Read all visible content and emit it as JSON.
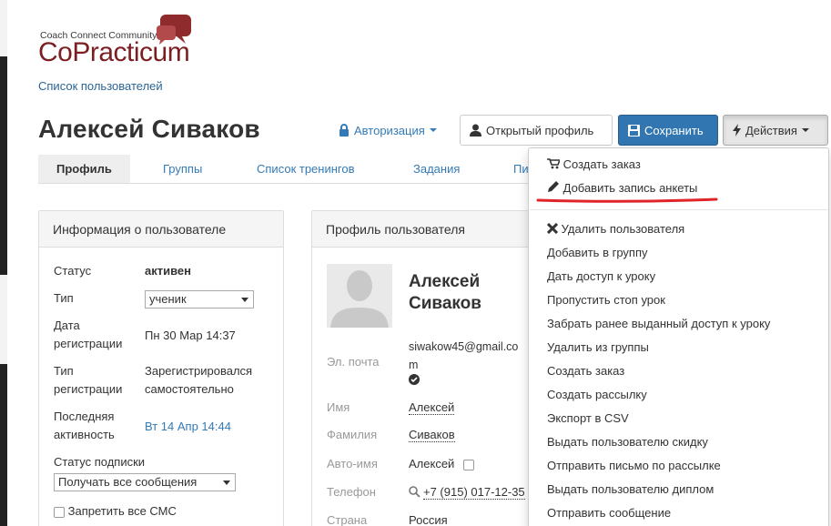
{
  "logo": {
    "tagline": "Coach Connect Community",
    "brand": "CoPracticum",
    "brand_color": "#7a1f22"
  },
  "breadcrumb": {
    "back_link": "Список пользователей"
  },
  "user": {
    "full_name": "Алексей Сиваков"
  },
  "toolbar": {
    "auth_label": "Авторизация",
    "auth_icon": "lock-icon",
    "open_profile_label": "Открытый профиль",
    "open_profile_icon": "user-icon",
    "save_label": "Сохранить",
    "save_icon": "floppy-icon",
    "actions_label": "Действия",
    "actions_icon": "bolt-icon",
    "save_color": "#3276b1"
  },
  "tabs": [
    {
      "label": "Профиль",
      "active": true
    },
    {
      "label": "Группы"
    },
    {
      "label": "Список тренингов"
    },
    {
      "label": "Задания"
    },
    {
      "label": "Пи"
    }
  ],
  "info_panel": {
    "title": "Информация о пользователе",
    "status_label": "Статус",
    "status_value": "активен",
    "type_label": "Тип",
    "type_value": "ученик",
    "reg_date_label_1": "Дата",
    "reg_date_label_2": "регистрации",
    "reg_date_value": "Пн 30 Мар 14:37",
    "reg_type_label_1": "Тип",
    "reg_type_label_2": "регистрации",
    "reg_type_value_1": "Зарегистрировался",
    "reg_type_value_2": "самостоятельно",
    "last_active_label_1": "Последняя",
    "last_active_label_2": "активность",
    "last_active_value": "Вт 14 Апр 14:44",
    "subscription_label": "Статус подписки",
    "subscription_value": "Получать все сообщения",
    "sms_label": "Запретить все СМС"
  },
  "profile_panel": {
    "title": "Профиль пользователя",
    "name_line_1": "Алексей",
    "name_line_2": "Сиваков",
    "email_label": "Эл. почта",
    "email_value_1": "siwakow45@gmail.co",
    "email_value_2": "m",
    "first_name_label": "Имя",
    "first_name_value": "Алексей",
    "last_name_label": "Фамилия",
    "last_name_value": "Сиваков",
    "auto_name_label": "Авто-имя",
    "auto_name_value": "Алексей",
    "phone_label": "Телефон",
    "phone_value": "+7 (915) 017-12-35",
    "country_label": "Страна",
    "country_value": "Россия"
  },
  "actions_menu": {
    "items": [
      {
        "label": "Создать заказ",
        "icon": "cart-icon"
      },
      {
        "label": "Добавить запись анкеты",
        "icon": "pencil-icon"
      },
      {
        "label": "Удалить пользователя",
        "icon": "close-icon"
      },
      {
        "label": "Добавить в группу"
      },
      {
        "label": "Дать доступ к уроку"
      },
      {
        "label": "Пропустить стоп урок"
      },
      {
        "label": "Забрать ранее выданный доступ к уроку"
      },
      {
        "label": "Удалить из группы"
      },
      {
        "label": "Создать заказ"
      },
      {
        "label": "Создать рассылку"
      },
      {
        "label": "Экспорт в CSV"
      },
      {
        "label": "Выдать пользователю скидку"
      },
      {
        "label": "Отправить письмо по рассылке"
      },
      {
        "label": "Выдать пользователю диплом"
      },
      {
        "label": "Отправить сообщение"
      }
    ],
    "highlight_color": "#e0242a"
  }
}
